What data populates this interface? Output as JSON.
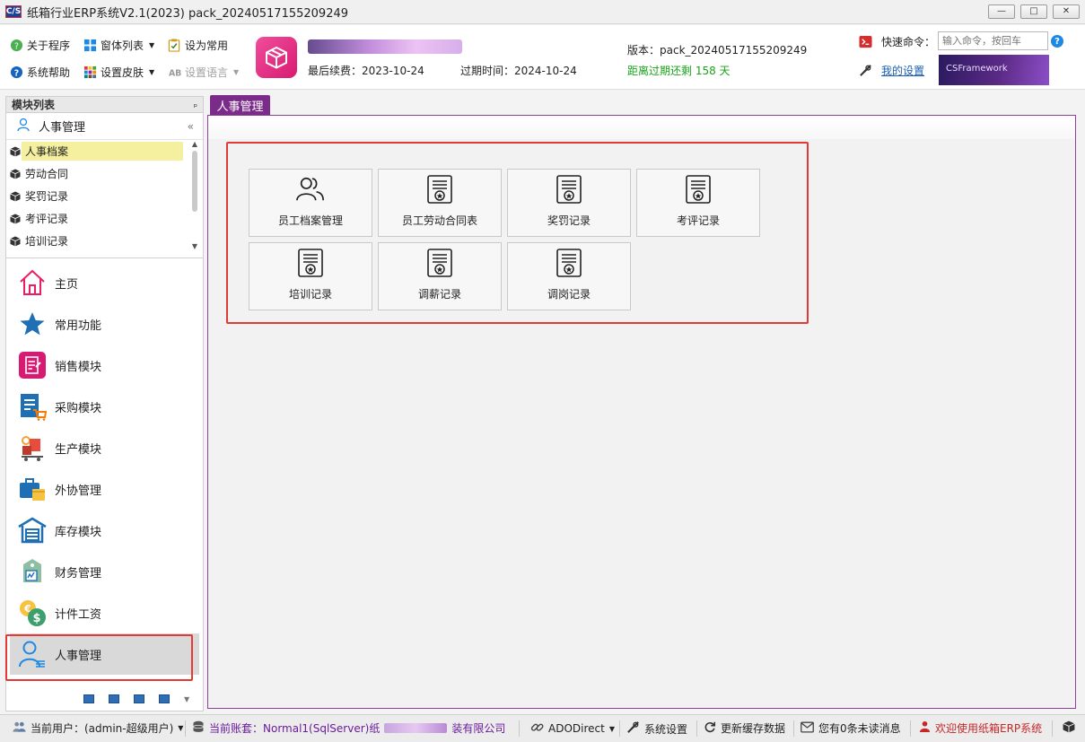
{
  "window": {
    "title": "纸箱行业ERP系统V2.1(2023) pack_20240517155209249",
    "app_icon_text": "C/S"
  },
  "toolbar": {
    "about": "关于程序",
    "window_list": "窗体列表",
    "set_common": "设为常用",
    "help": "系统帮助",
    "skin": "设置皮肤",
    "language": "设置语言"
  },
  "header": {
    "renew_label": "最后续费：2023-10-24",
    "expire_label": "过期时间：2024-10-24",
    "version_label": "版本：pack_20240517155209249",
    "remaining": "距离过期还剩 158 天",
    "quick_cmd_label": "快速命令：",
    "quick_cmd_placeholder": "输入命令，按回车",
    "my_settings": "我的设置",
    "banner_text": "CSFramework"
  },
  "left_panel": {
    "title": "模块列表",
    "pin": "ₚ",
    "group_title": "人事管理",
    "collapse": "«",
    "tree": [
      {
        "label": "人事档案"
      },
      {
        "label": "劳动合同"
      },
      {
        "label": "奖罚记录"
      },
      {
        "label": "考评记录"
      },
      {
        "label": "培训记录"
      }
    ],
    "nav": [
      {
        "label": "主页"
      },
      {
        "label": "常用功能"
      },
      {
        "label": "销售模块"
      },
      {
        "label": "采购模块"
      },
      {
        "label": "生产模块"
      },
      {
        "label": "外协管理"
      },
      {
        "label": "库存模块"
      },
      {
        "label": "财务管理"
      },
      {
        "label": "计件工资"
      },
      {
        "label": "人事管理"
      }
    ]
  },
  "main": {
    "tab_label": "人事管理",
    "tiles": [
      {
        "label": "员工档案管理",
        "icon": "users-icon"
      },
      {
        "label": "员工劳动合同表",
        "icon": "certificate-icon"
      },
      {
        "label": "奖罚记录",
        "icon": "certificate-icon"
      },
      {
        "label": "考评记录",
        "icon": "certificate-icon"
      },
      {
        "label": "培训记录",
        "icon": "certificate-icon"
      },
      {
        "label": "调薪记录",
        "icon": "certificate-icon"
      },
      {
        "label": "调岗记录",
        "icon": "certificate-icon"
      }
    ]
  },
  "statusbar": {
    "user": "当前用户：(admin-超级用户)",
    "account_prefix": "当前账套：Normal1(SqlServer)纸",
    "account_suffix": "装有限公司",
    "conn": "ADODirect",
    "settings": "系统设置",
    "refresh_cache": "更新缓存数据",
    "messages": "您有0条未读消息",
    "welcome": "欢迎使用纸箱ERP系统"
  },
  "colors": {
    "accent_purple": "#7b2c8a",
    "highlight_red": "#e53935",
    "remaining_green": "#1aa31a",
    "brand_pink": "#d81b72"
  }
}
